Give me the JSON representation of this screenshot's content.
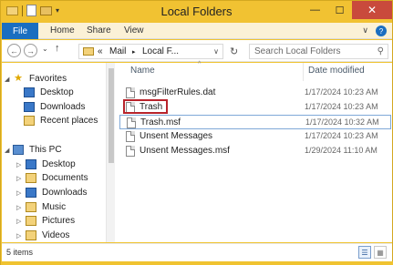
{
  "window": {
    "title": "Local Folders",
    "controls": {
      "minimize": "—",
      "maximize": "☐",
      "close": "✕"
    },
    "accent": "#f1c232"
  },
  "ribbon": {
    "file_tab": "File",
    "tabs": [
      "Home",
      "Share",
      "View"
    ],
    "collapse_icon": "∨",
    "help_icon": "?"
  },
  "address": {
    "back": "←",
    "forward": "→",
    "recent": "⌄",
    "up": "↑",
    "overflow": "«",
    "crumbs": [
      "Mail",
      "Local F..."
    ],
    "separator": "▸",
    "dropdown": "∨",
    "refresh": "↻",
    "search_placeholder": "Search Local Folders",
    "search_icon": "⚲"
  },
  "nav": {
    "favorites_label": "Favorites",
    "favorites": [
      "Desktop",
      "Downloads",
      "Recent places"
    ],
    "thispc_label": "This PC",
    "thispc": [
      "Desktop",
      "Documents",
      "Downloads",
      "Music",
      "Pictures",
      "Videos"
    ]
  },
  "files": {
    "col_name": "Name",
    "col_date": "Date modified",
    "sort_caret": "^",
    "rows": [
      {
        "name": "msgFilterRules.dat",
        "date": "1/17/2024 10:23 AM"
      },
      {
        "name": "Trash",
        "date": "1/17/2024 10:23 AM"
      },
      {
        "name": "Trash.msf",
        "date": "1/17/2024 10:32 AM"
      },
      {
        "name": "Unsent Messages",
        "date": "1/17/2024 10:23 AM"
      },
      {
        "name": "Unsent Messages.msf",
        "date": "1/29/2024 11:10 AM"
      }
    ]
  },
  "status": {
    "count": "5 items"
  }
}
